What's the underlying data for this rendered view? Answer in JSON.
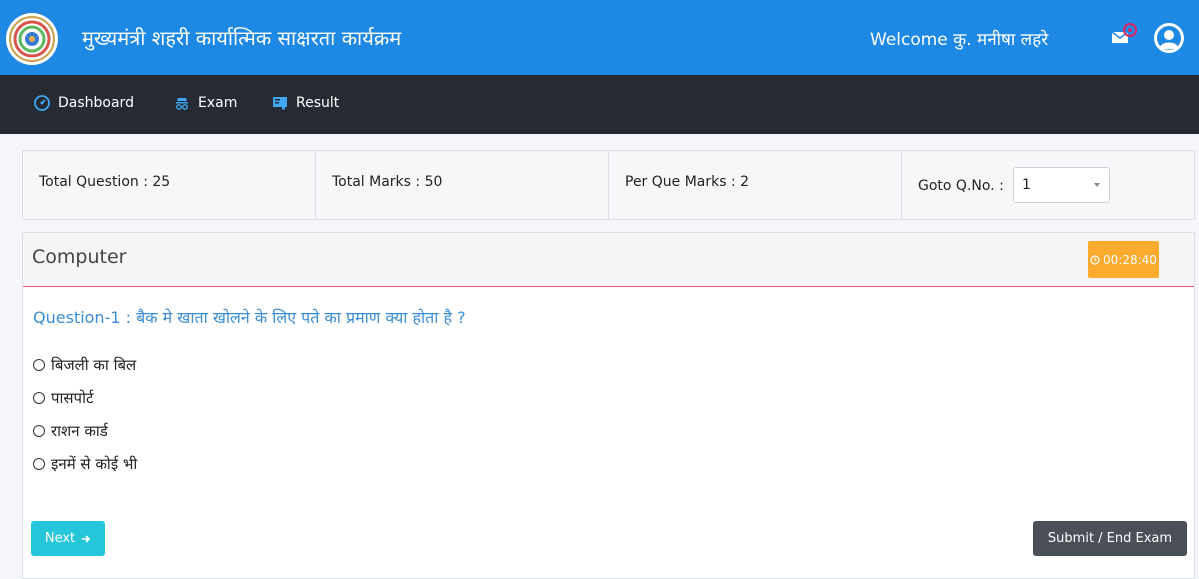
{
  "header": {
    "title": "मुख्यमंत्री शहरी कार्यात्मिक साक्षरता कार्यक्रम",
    "welcome": "Welcome कु. मनीषा लहरे",
    "brand_color": "#1e88e5"
  },
  "nav": {
    "items": [
      {
        "label": "Dashboard",
        "icon": "dashboard-icon"
      },
      {
        "label": "Exam",
        "icon": "exam-icon"
      },
      {
        "label": "Result",
        "icon": "result-icon"
      }
    ]
  },
  "stats": {
    "total_question": "Total Question : 25",
    "total_marks": "Total Marks : 50",
    "per_que_marks": "Per Que Marks : 2",
    "goto_label": "Goto Q.No. :",
    "goto_value": "1"
  },
  "exam": {
    "subject": "Computer",
    "timer": "00:28:40",
    "question": "Question-1 : बैक मे खाता खोलने के लिए पते का प्रमाण क्या होता है ?",
    "options": [
      "बिजली का बिल",
      "पासपोर्ट",
      "राशन कार्ड",
      "इनमें से कोई भी"
    ],
    "next_label": "Next",
    "submit_label": "Submit / End Exam",
    "timer_color": "#fbab2d",
    "next_color": "#26c6da"
  }
}
